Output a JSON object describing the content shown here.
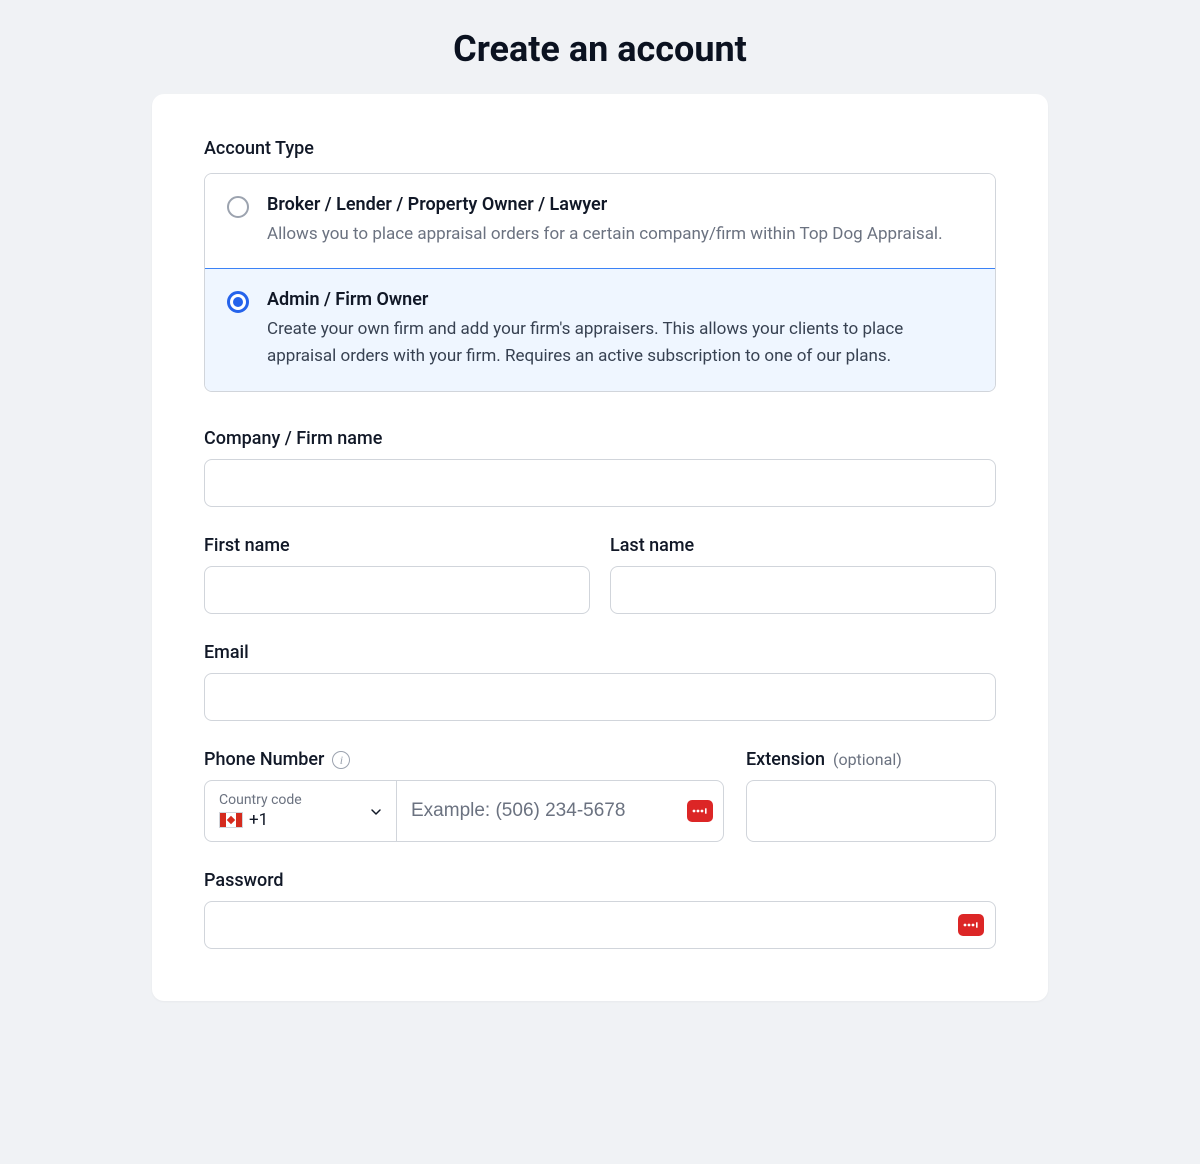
{
  "page": {
    "title": "Create an account"
  },
  "accountType": {
    "label": "Account Type",
    "options": [
      {
        "title": "Broker / Lender / Property Owner / Lawyer",
        "description": "Allows you to place appraisal orders for a certain company/firm within Top Dog Appraisal.",
        "selected": false
      },
      {
        "title": "Admin / Firm Owner",
        "description": "Create your own firm and add your firm's appraisers. This allows your clients to place appraisal orders with your firm. Requires an active subscription to one of our plans.",
        "selected": true
      }
    ]
  },
  "fields": {
    "company": {
      "label": "Company / Firm name",
      "value": ""
    },
    "firstName": {
      "label": "First name",
      "value": ""
    },
    "lastName": {
      "label": "Last name",
      "value": ""
    },
    "email": {
      "label": "Email",
      "value": ""
    },
    "phone": {
      "label": "Phone Number",
      "countryCodeLabel": "Country code",
      "countryCode": "+1",
      "placeholder": "Example: (506) 234-5678",
      "value": ""
    },
    "extension": {
      "label": "Extension",
      "optionalHint": "(optional)",
      "value": ""
    },
    "password": {
      "label": "Password",
      "value": ""
    }
  },
  "icons": {
    "passwordManagerBadge": "•••|"
  }
}
